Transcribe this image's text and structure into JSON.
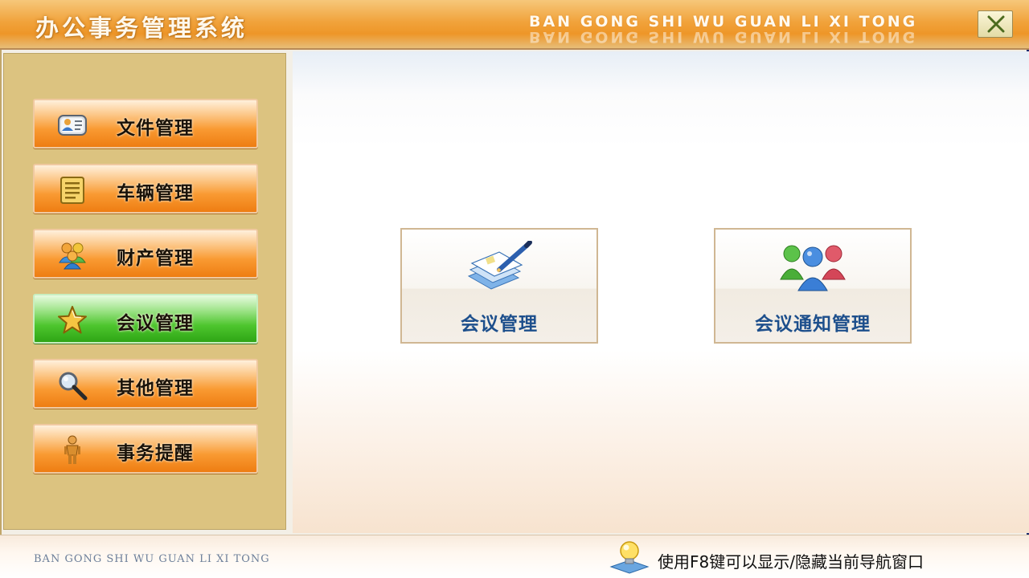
{
  "titlebar": {
    "title": "办公事务管理系统",
    "pinyin": "BAN GONG SHI WU  GUAN LI XI TONG",
    "close_icon": "close-icon"
  },
  "sidebar": {
    "items": [
      {
        "label": "文件管理",
        "icon": "contact-card-icon",
        "active": false
      },
      {
        "label": "车辆管理",
        "icon": "document-list-icon",
        "active": false
      },
      {
        "label": "财产管理",
        "icon": "users-group-icon",
        "active": false
      },
      {
        "label": "会议管理",
        "icon": "star-icon",
        "active": true
      },
      {
        "label": "其他管理",
        "icon": "magnifier-icon",
        "active": false
      },
      {
        "label": "事务提醒",
        "icon": "person-icon",
        "active": false
      }
    ]
  },
  "main": {
    "tiles": [
      {
        "label": "会议管理",
        "icon": "notepad-pen-icon"
      },
      {
        "label": "会议通知管理",
        "icon": "people-group-icon"
      }
    ]
  },
  "statusbar": {
    "pinyin": "BAN GONG SHI WU GUAN LI XI TONG",
    "tip": "使用F8键可以显示/隐藏当前导航窗口",
    "tip_icon": "lightbulb-icon"
  },
  "colors": {
    "title_orange": "#f1a33c",
    "sidebar_bg": "#dcc380",
    "button_orange": "#f99a32",
    "button_active_green": "#4dc52d",
    "tile_label_blue": "#1d4f8c"
  }
}
